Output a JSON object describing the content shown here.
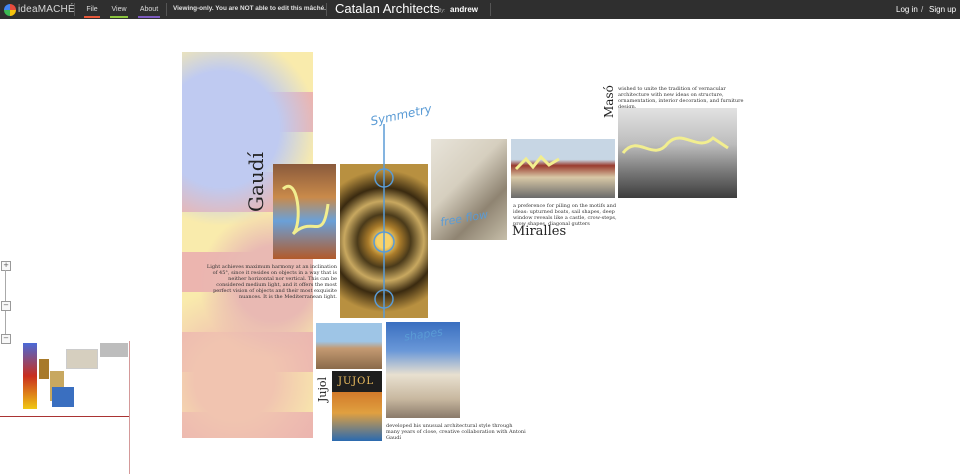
{
  "app": {
    "logo_text": "ideaMACHÉ"
  },
  "menu": [
    {
      "label": "File",
      "color": "#e8593b"
    },
    {
      "label": "View",
      "color": "#8cc63f"
    },
    {
      "label": "About",
      "color": "#7d5bbf"
    }
  ],
  "notice": "Viewing-only. You are NOT able to edit this mâché.",
  "mache": {
    "title": "Catalan Architects",
    "by_label": "By:",
    "author": "andrew"
  },
  "auth": {
    "login": "Log in",
    "separator": "/",
    "signup": "Sign up"
  },
  "canvas": {
    "gaudi": {
      "heading": "Gaudí",
      "text": "Light achieves maximum harmony at an inclination of 45°, since it resides on objects in a way that is neither horizontal nor vertical. This can be considered medium light, and it offers the most perfect vision of objects and their most exquisite nuances. It is the Mediterranean light."
    },
    "miralles": {
      "heading": "Miralles",
      "text": "a preference for piling on the motifs and ideas: upturned boats, sail shapes, deep window reveals like a castle, crow-steps, prow shapes, diagonal gutters"
    },
    "maso": {
      "heading": "Masó",
      "text": "wished to unite the tradition of vernacular architecture with new ideas on structure, ornamentation, interior decoration, and furniture design."
    },
    "jujol": {
      "heading": "Jujol",
      "sign_text": "JUJOL",
      "text": "developed his unusual architectural style through many years of close, creative collaboration with Antoni Gaudí"
    },
    "sketches": {
      "symmetry": "Symmetry",
      "freeflow": "free flow",
      "shapes": "shapes"
    }
  },
  "zoom": {
    "in": "+",
    "out": "−",
    "mid": "−"
  },
  "colors": {
    "topbar": "#2f2f2f",
    "sketch_blue": "#5a9bd5",
    "highlight_yellow": "#f2ee8f"
  }
}
